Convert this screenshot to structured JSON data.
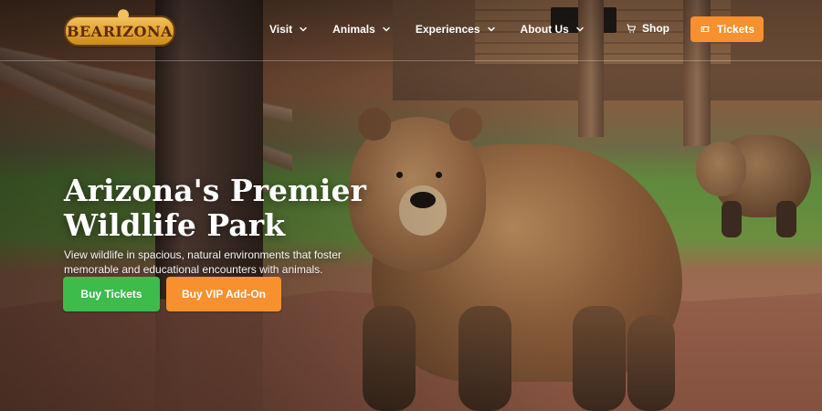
{
  "brand": {
    "logo_text": "BEARIZONA"
  },
  "header": {
    "nav": [
      {
        "label": "Visit"
      },
      {
        "label": "Animals"
      },
      {
        "label": "Experiences"
      },
      {
        "label": "About Us"
      }
    ],
    "shop_label": "Shop",
    "tickets_label": "Tickets",
    "icons": {
      "chevron": "chevron-down-icon",
      "cart": "shopping-cart-icon",
      "ticket": "ticket-icon"
    },
    "colors": {
      "tickets_bg": "#f7902f"
    }
  },
  "hero": {
    "title": "Arizona's Premier Wildlife Park",
    "subtitle": "View wildlife in spacious, natural environments that foster memorable and educational encounters with animals.",
    "buttons": {
      "primary_label": "Buy Tickets",
      "secondary_label": "Buy VIP Add-On"
    },
    "colors": {
      "primary": "#3dbb4b",
      "secondary": "#f7902f"
    }
  }
}
